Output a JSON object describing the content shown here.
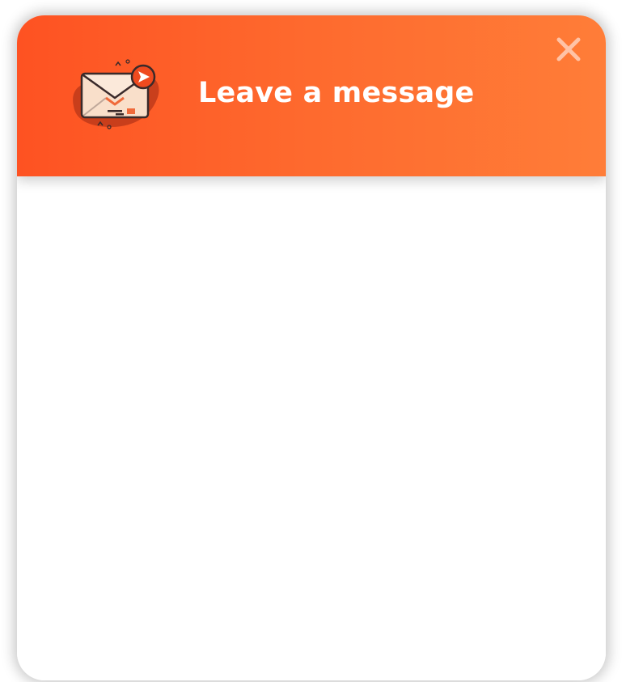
{
  "header": {
    "title": "Leave a message",
    "icon": "envelope-send-icon",
    "close_icon": "close-icon"
  },
  "colors": {
    "header_gradient_start": "#fe5222",
    "header_gradient_end": "#ff7d38",
    "title_text": "#ffffff",
    "close_icon": "#ffc3a6",
    "body_background": "#ffffff"
  }
}
